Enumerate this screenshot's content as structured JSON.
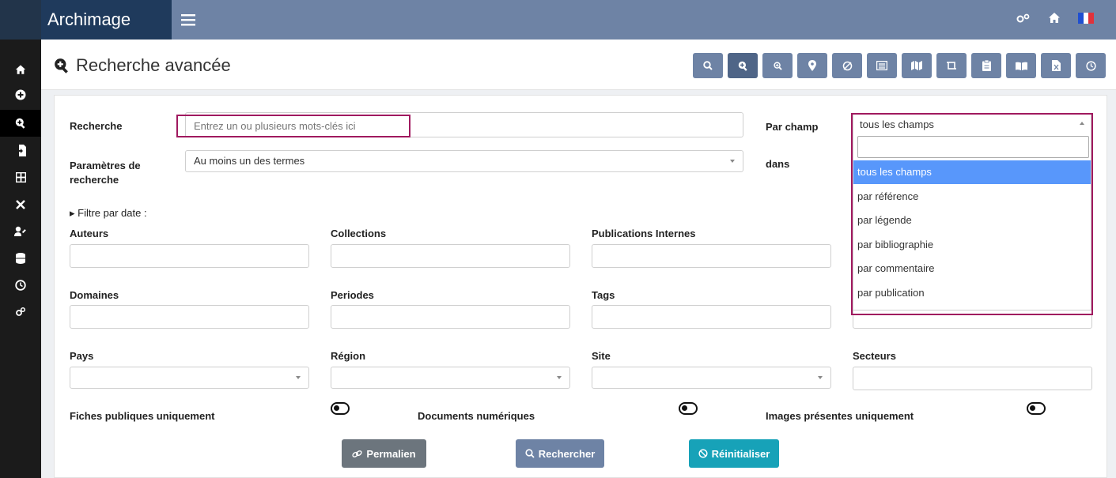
{
  "app": {
    "brand": "Archimage"
  },
  "page": {
    "title": "Recherche avancée"
  },
  "toolbar": {
    "buttons": [
      "search-icon",
      "search-plus-icon",
      "zoom-icon",
      "map-marker-icon",
      "no-location-icon",
      "list-icon",
      "map-icon",
      "crop-icon",
      "clipboard-icon",
      "book-open-icon",
      "excel-file-icon",
      "clock-icon"
    ]
  },
  "sidebar": {
    "items": [
      "home-icon",
      "plus-circle-icon",
      "search-plus-icon",
      "file-import-icon",
      "grid-icon",
      "tools-icon",
      "user-edit-icon",
      "database-icon",
      "clock-icon",
      "cogs-icon"
    ],
    "active_index": 2
  },
  "form": {
    "recherche_label": "Recherche",
    "recherche_placeholder": "Entrez un ou plusieurs mots-clés ici",
    "parametres_label_line1": "Paramètres de",
    "parametres_label_line2": "recherche",
    "parametres_value": "Au moins un des termes",
    "par_champ_label": "Par champ",
    "dans_label": "dans",
    "filtre_date": "▸ Filtre par date :",
    "auteurs": "Auteurs",
    "collections": "Collections",
    "publications_internes": "Publications Internes",
    "domaines": "Domaines",
    "periodes": "Periodes",
    "tags": "Tags",
    "pays": "Pays",
    "region": "Région",
    "site": "Site",
    "secteurs": "Secteurs",
    "fiches_publiques": "Fiches publiques uniquement",
    "documents_numeriques": "Documents numériques",
    "images_presentes": "Images présentes uniquement"
  },
  "dropdown": {
    "selected": "tous les champs",
    "options": [
      "tous les champs",
      "par référence",
      "par légende",
      "par bibliographie",
      "par commentaire",
      "par publication"
    ],
    "highlighted_index": 0
  },
  "buttons": {
    "permalien": "Permalien",
    "rechercher": "Rechercher",
    "reinitialiser": "Réinitialiser"
  },
  "colors": {
    "topbar": "#6e83a5",
    "brand_bg": "#1f3a5c",
    "sidebar": "#1b1b1b",
    "highlight": "#a0195f",
    "permalien": "#6c757d",
    "rechercher": "#6e83a5",
    "reinitialiser": "#17a2b8"
  }
}
